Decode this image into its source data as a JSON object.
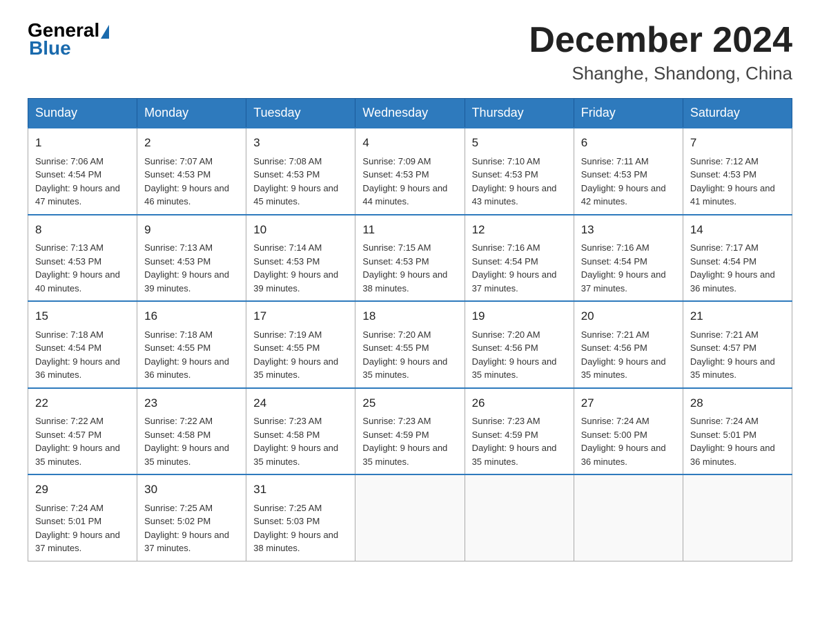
{
  "header": {
    "logo_general": "General",
    "logo_blue": "Blue",
    "month_title": "December 2024",
    "location": "Shanghe, Shandong, China"
  },
  "days_of_week": [
    "Sunday",
    "Monday",
    "Tuesday",
    "Wednesday",
    "Thursday",
    "Friday",
    "Saturday"
  ],
  "weeks": [
    [
      {
        "day": 1,
        "sunrise": "7:06 AM",
        "sunset": "4:54 PM",
        "daylight": "9 hours and 47 minutes."
      },
      {
        "day": 2,
        "sunrise": "7:07 AM",
        "sunset": "4:53 PM",
        "daylight": "9 hours and 46 minutes."
      },
      {
        "day": 3,
        "sunrise": "7:08 AM",
        "sunset": "4:53 PM",
        "daylight": "9 hours and 45 minutes."
      },
      {
        "day": 4,
        "sunrise": "7:09 AM",
        "sunset": "4:53 PM",
        "daylight": "9 hours and 44 minutes."
      },
      {
        "day": 5,
        "sunrise": "7:10 AM",
        "sunset": "4:53 PM",
        "daylight": "9 hours and 43 minutes."
      },
      {
        "day": 6,
        "sunrise": "7:11 AM",
        "sunset": "4:53 PM",
        "daylight": "9 hours and 42 minutes."
      },
      {
        "day": 7,
        "sunrise": "7:12 AM",
        "sunset": "4:53 PM",
        "daylight": "9 hours and 41 minutes."
      }
    ],
    [
      {
        "day": 8,
        "sunrise": "7:13 AM",
        "sunset": "4:53 PM",
        "daylight": "9 hours and 40 minutes."
      },
      {
        "day": 9,
        "sunrise": "7:13 AM",
        "sunset": "4:53 PM",
        "daylight": "9 hours and 39 minutes."
      },
      {
        "day": 10,
        "sunrise": "7:14 AM",
        "sunset": "4:53 PM",
        "daylight": "9 hours and 39 minutes."
      },
      {
        "day": 11,
        "sunrise": "7:15 AM",
        "sunset": "4:53 PM",
        "daylight": "9 hours and 38 minutes."
      },
      {
        "day": 12,
        "sunrise": "7:16 AM",
        "sunset": "4:54 PM",
        "daylight": "9 hours and 37 minutes."
      },
      {
        "day": 13,
        "sunrise": "7:16 AM",
        "sunset": "4:54 PM",
        "daylight": "9 hours and 37 minutes."
      },
      {
        "day": 14,
        "sunrise": "7:17 AM",
        "sunset": "4:54 PM",
        "daylight": "9 hours and 36 minutes."
      }
    ],
    [
      {
        "day": 15,
        "sunrise": "7:18 AM",
        "sunset": "4:54 PM",
        "daylight": "9 hours and 36 minutes."
      },
      {
        "day": 16,
        "sunrise": "7:18 AM",
        "sunset": "4:55 PM",
        "daylight": "9 hours and 36 minutes."
      },
      {
        "day": 17,
        "sunrise": "7:19 AM",
        "sunset": "4:55 PM",
        "daylight": "9 hours and 35 minutes."
      },
      {
        "day": 18,
        "sunrise": "7:20 AM",
        "sunset": "4:55 PM",
        "daylight": "9 hours and 35 minutes."
      },
      {
        "day": 19,
        "sunrise": "7:20 AM",
        "sunset": "4:56 PM",
        "daylight": "9 hours and 35 minutes."
      },
      {
        "day": 20,
        "sunrise": "7:21 AM",
        "sunset": "4:56 PM",
        "daylight": "9 hours and 35 minutes."
      },
      {
        "day": 21,
        "sunrise": "7:21 AM",
        "sunset": "4:57 PM",
        "daylight": "9 hours and 35 minutes."
      }
    ],
    [
      {
        "day": 22,
        "sunrise": "7:22 AM",
        "sunset": "4:57 PM",
        "daylight": "9 hours and 35 minutes."
      },
      {
        "day": 23,
        "sunrise": "7:22 AM",
        "sunset": "4:58 PM",
        "daylight": "9 hours and 35 minutes."
      },
      {
        "day": 24,
        "sunrise": "7:23 AM",
        "sunset": "4:58 PM",
        "daylight": "9 hours and 35 minutes."
      },
      {
        "day": 25,
        "sunrise": "7:23 AM",
        "sunset": "4:59 PM",
        "daylight": "9 hours and 35 minutes."
      },
      {
        "day": 26,
        "sunrise": "7:23 AM",
        "sunset": "4:59 PM",
        "daylight": "9 hours and 35 minutes."
      },
      {
        "day": 27,
        "sunrise": "7:24 AM",
        "sunset": "5:00 PM",
        "daylight": "9 hours and 36 minutes."
      },
      {
        "day": 28,
        "sunrise": "7:24 AM",
        "sunset": "5:01 PM",
        "daylight": "9 hours and 36 minutes."
      }
    ],
    [
      {
        "day": 29,
        "sunrise": "7:24 AM",
        "sunset": "5:01 PM",
        "daylight": "9 hours and 37 minutes."
      },
      {
        "day": 30,
        "sunrise": "7:25 AM",
        "sunset": "5:02 PM",
        "daylight": "9 hours and 37 minutes."
      },
      {
        "day": 31,
        "sunrise": "7:25 AM",
        "sunset": "5:03 PM",
        "daylight": "9 hours and 38 minutes."
      },
      null,
      null,
      null,
      null
    ]
  ]
}
